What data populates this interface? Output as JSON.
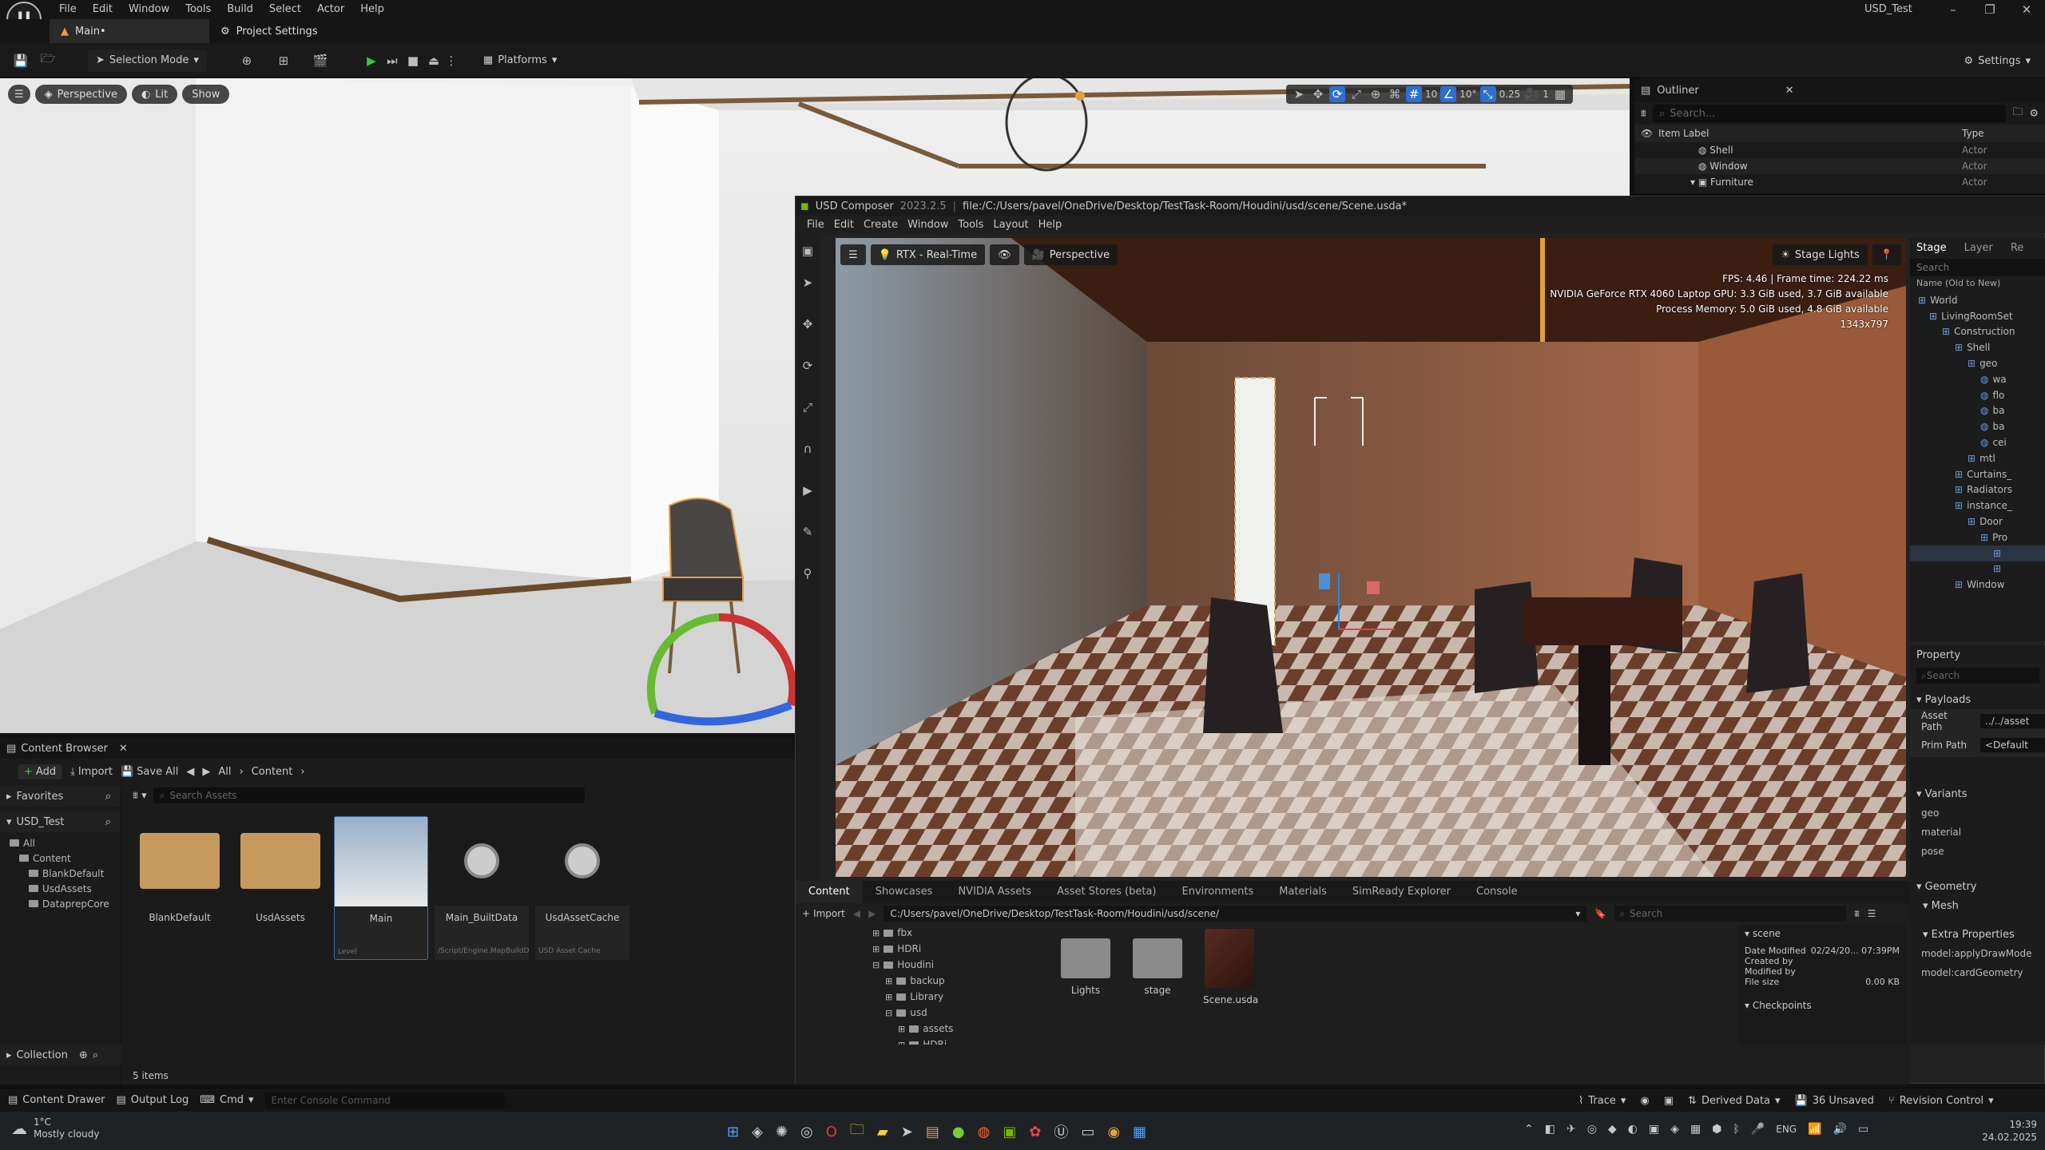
{
  "ue": {
    "menu": [
      "File",
      "Edit",
      "Window",
      "Tools",
      "Build",
      "Select",
      "Actor",
      "Help"
    ],
    "project_title": "USD_Test",
    "tabs": {
      "main": "Main•",
      "project_settings": "Project Settings"
    },
    "toolbar": {
      "selection_mode": "Selection Mode",
      "platforms": "Platforms",
      "settings": "Settings"
    },
    "viewport": {
      "perspective": "Perspective",
      "lit": "Lit",
      "show": "Show",
      "grid_snap": "10",
      "rot_snap": "10°",
      "scale_snap": "0.25",
      "cam_speed": "1"
    },
    "outliner": {
      "title": "Outliner",
      "search_placeholder": "Search...",
      "col_label": "Item Label",
      "col_type": "Type",
      "rows": [
        {
          "label": "Shell",
          "type": "Actor"
        },
        {
          "label": "Window",
          "type": "Actor"
        },
        {
          "label": "Furniture",
          "type": "Actor"
        }
      ]
    },
    "content_browser": {
      "title": "Content Browser",
      "add": "Add",
      "import": "Import",
      "save_all": "Save All",
      "path": [
        "All",
        "Content"
      ],
      "search_placeholder": "Search Assets",
      "favorites": "Favorites",
      "project": "USD_Test",
      "tree": [
        "All",
        "Content",
        "BlankDefault",
        "UsdAssets",
        "DataprepCore"
      ],
      "assets": [
        {
          "name": "BlankDefault",
          "sub": ""
        },
        {
          "name": "UsdAssets",
          "sub": ""
        },
        {
          "name": "Main",
          "sub": "Level"
        },
        {
          "name": "Main_BuiltData",
          "sub": "/Script/Engine.MapBuildD..."
        },
        {
          "name": "UsdAssetCache",
          "sub": "USD Asset Cache"
        }
      ],
      "count": "5 items",
      "collections": "Collection"
    },
    "status": {
      "content_drawer": "Content Drawer",
      "output_log": "Output Log",
      "cmd": "Cmd",
      "console_placeholder": "Enter Console Command",
      "trace": "Trace",
      "derived_data": "Derived Data",
      "unsaved": "36 Unsaved",
      "revision_control": "Revision Control"
    }
  },
  "usd": {
    "app": "USD Composer",
    "version": "2023.2.5",
    "file": "file:/C:/Users/pavel/OneDrive/Desktop/TestTask-Room/Houdini/usd/scene/Scene.usda*",
    "menu": [
      "File",
      "Edit",
      "Create",
      "Window",
      "Tools",
      "Layout",
      "Help"
    ],
    "viewport": {
      "renderer": "RTX - Real-Time",
      "camera": "Perspective",
      "lights": "Stage Lights",
      "stats": [
        "FPS: 4.46  |  Frame time: 224.22 ms",
        "NVIDIA GeForce RTX 4060 Laptop GPU: 3.3 GiB used, 3.7 GiB available",
        "Process Memory: 5.0 GiB used, 4.8 GiB available",
        "1343x797"
      ]
    },
    "stage": {
      "tabs": [
        "Stage",
        "Layer",
        "Re"
      ],
      "search_placeholder": "Search",
      "header": "Name (Old to New)",
      "tree": [
        "World",
        "LivingRoomSet",
        "Construction",
        "Shell",
        "geo",
        "wa",
        "flo",
        "ba",
        "ba",
        "cei",
        "mtl",
        "Curtains_",
        "Radiators",
        "instance_",
        "Door",
        "Pro",
        "",
        "",
        "Window"
      ]
    },
    "property": {
      "title": "Property",
      "search_placeholder": "Search",
      "payloads": "Payloads",
      "asset_path_label": "Asset Path",
      "asset_path": "../../asset",
      "prim_path_label": "Prim Path",
      "prim_path": "<Default",
      "variants": "Variants",
      "variant_items": [
        "geo",
        "material",
        "pose"
      ],
      "geometry": "Geometry",
      "mesh": "Mesh",
      "extra": "Extra Properties",
      "extra_items": [
        "model:applyDrawMode",
        "model:cardGeometry"
      ]
    },
    "bottom_tabs": [
      "Content",
      "Showcases",
      "NVIDIA Assets",
      "Asset Stores (beta)",
      "Environments",
      "Materials",
      "SimReady Explorer",
      "Console"
    ],
    "import": "Import",
    "path": "C:/Users/pavel/OneDrive/Desktop/TestTask-Room/Houdini/usd/scene/",
    "search_placeholder": "Search",
    "folder_tree": [
      "fbx",
      "HDRi",
      "Houdini",
      "backup",
      "Library",
      "usd",
      "assets",
      "HDRi"
    ],
    "files": [
      "Lights",
      "stage",
      "Scene.usda"
    ],
    "details": {
      "name": "scene",
      "date_modified_label": "Date Modified",
      "date_modified": "02/24/20... 07:39PM",
      "created_by_label": "Created by",
      "modified_by_label": "Modified by",
      "file_size_label": "File size",
      "file_size": "0.00 KB",
      "checkpoints": "Checkpoints"
    }
  },
  "taskbar": {
    "weather_temp": "1°C",
    "weather_desc": "Mostly cloudy",
    "lang": "ENG",
    "time": "19:39",
    "date": "24.02.2025"
  }
}
